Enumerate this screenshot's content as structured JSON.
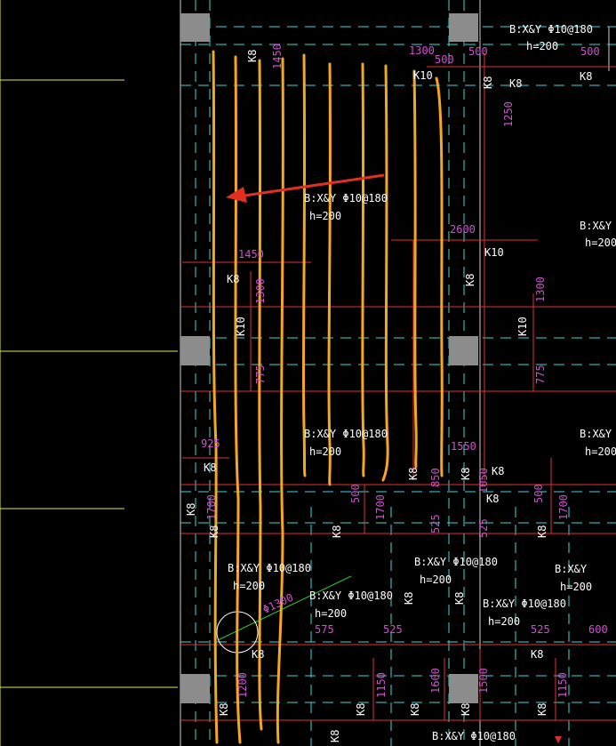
{
  "colors": {
    "background": "#000000",
    "column": "#8c8c8c",
    "rebar_highlight": "#f5a623",
    "beam_red": "#e23030",
    "dim_magenta": "#d24fd2",
    "cyan_dash": "#3fd6d6",
    "yellow_axis": "#e8e83a",
    "text_white": "#ffffff",
    "arrow_red": "#e03020",
    "green_line": "#30d030"
  },
  "slab_labels": [
    {
      "reinf": "B:X&Y Φ10@180",
      "thickness": "h=200"
    },
    {
      "reinf": "B:X&Y Φ10@180",
      "thickness": "h=200"
    },
    {
      "reinf": "B:X&Y Φ10@180",
      "thickness": "h=200"
    },
    {
      "reinf": "B:X&Y",
      "thickness": "h=200"
    },
    {
      "reinf": "B:X&Y",
      "thickness": "h=200"
    },
    {
      "reinf": "B:X&Y Φ10@180",
      "thickness": "h=200"
    },
    {
      "reinf": "B:X&Y Φ10@180",
      "thickness": "h=200"
    },
    {
      "reinf": "B:X&Y Φ10@180",
      "thickness": "h=200"
    },
    {
      "reinf": "B:X&Y Φ10@180",
      "thickness": "h=200"
    },
    {
      "reinf": "B:X&Y",
      "thickness": "h=200"
    },
    {
      "reinf": "B:X&Y Φ10@180",
      "thickness": ""
    }
  ],
  "beam_codes": {
    "k8": "K8",
    "k10": "K10"
  },
  "dimensions": {
    "d1450": "1450",
    "d1300": "1300",
    "d500": "500",
    "d2600": "2600",
    "d1250": "1250",
    "d775": "775",
    "d925": "925",
    "d1550": "1550",
    "d1700": "1700",
    "d525": "525",
    "d575": "575",
    "d600": "600",
    "d1200": "1200",
    "d1150": "1150",
    "d850": "850",
    "d1050": "1050",
    "d1500": "1500",
    "d1600": "1600",
    "d1300b": "1300",
    "dia": "Φ1300"
  }
}
